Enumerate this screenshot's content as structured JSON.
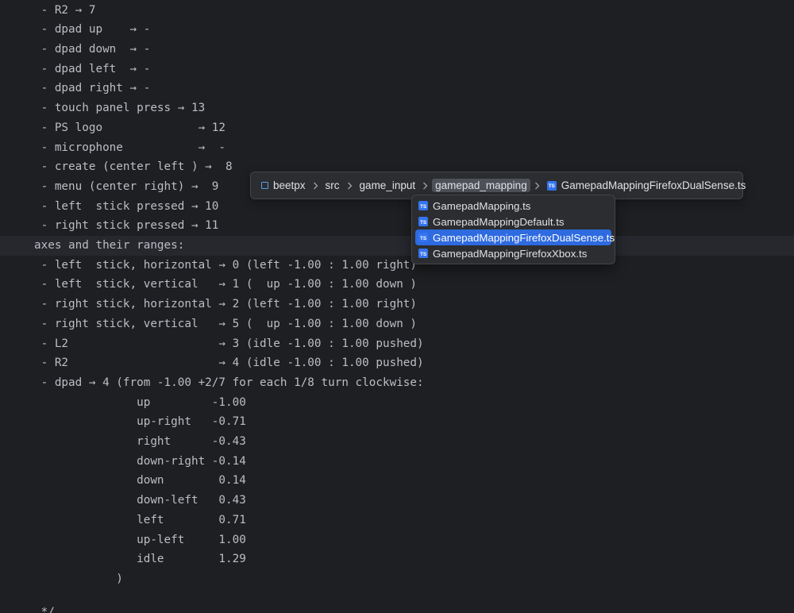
{
  "editor": {
    "lines": [
      " - R2 → 7",
      " - dpad up    → -",
      " - dpad down  → -",
      " - dpad left  → -",
      " - dpad right → -",
      " - touch panel press → 13",
      " - PS logo              → 12",
      " - microphone           →  -",
      " - create (center left ) →  8",
      " - menu (center right) →  9",
      " - left  stick pressed → 10",
      " - right stick pressed → 11",
      "axes and their ranges:",
      " - left  stick, horizontal → 0 (left -1.00 : 1.00 right)",
      " - left  stick, vertical   → 1 (  up -1.00 : 1.00 down )",
      " - right stick, horizontal → 2 (left -1.00 : 1.00 right)",
      " - right stick, vertical   → 5 (  up -1.00 : 1.00 down )",
      " - L2                      → 3 (idle -1.00 : 1.00 pushed)",
      " - R2                      → 4 (idle -1.00 : 1.00 pushed)",
      " - dpad → 4 (from -1.00 +2/7 for each 1/8 turn clockwise:",
      "               up         -1.00",
      "               up-right   -0.71",
      "               right      -0.43",
      "               down-right -0.14",
      "               down        0.14",
      "               down-left   0.43",
      "               left        0.71",
      "               up-left     1.00",
      "               idle        1.29",
      "            )",
      "",
      " */"
    ],
    "current_line_index": 12
  },
  "breadcrumb": {
    "items": [
      {
        "label": "beetpx",
        "icon": "module-icon"
      },
      {
        "label": "src",
        "icon": ""
      },
      {
        "label": "game_input",
        "icon": ""
      },
      {
        "label": "gamepad_mapping",
        "icon": "",
        "active": true
      },
      {
        "label": "GamepadMappingFirefoxDualSense.ts",
        "icon": "ts-icon"
      }
    ],
    "separator_icon": "chevron-right-icon",
    "ts_badge": "TS"
  },
  "popup": {
    "items": [
      {
        "label": "GamepadMapping.ts",
        "icon": "ts-icon"
      },
      {
        "label": "GamepadMappingDefault.ts",
        "icon": "ts-icon"
      },
      {
        "label": "GamepadMappingFirefoxDualSense.ts",
        "icon": "ts-icon",
        "selected": true
      },
      {
        "label": "GamepadMappingFirefoxXbox.ts",
        "icon": "ts-icon"
      }
    ]
  },
  "colors": {
    "background": "#1e1f22",
    "current_line": "#26282e",
    "text": "#bcbec4",
    "accent": "#2e6ae0",
    "ts_icon": "#3574f0"
  }
}
